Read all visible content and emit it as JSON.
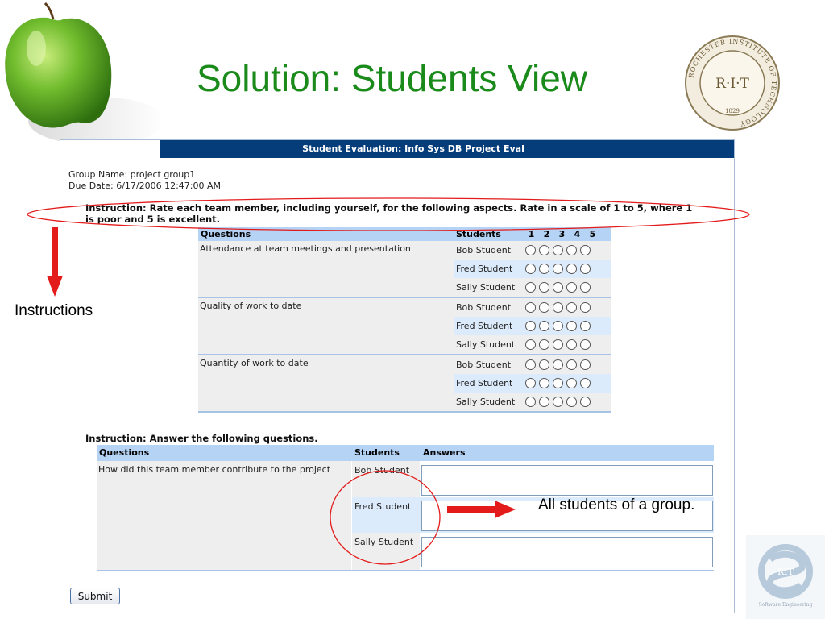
{
  "slide": {
    "title": "Solution: Students View"
  },
  "seal": {
    "center": "R·I·T",
    "ring": "ROCHESTER INSTITUTE OF TECHNOLOGY",
    "year": "1829"
  },
  "se_logo": {
    "monogram": "RIT",
    "caption": "Software Engineering"
  },
  "form": {
    "header_title": "Student Evaluation: Info Sys DB Project Eval",
    "group_name": "Group Name: project group1",
    "due_date": "Due Date: 6/17/2006 12:47:00 AM",
    "instruction_rating_1": "Instruction: Rate each team member, including yourself, for the following aspects. Rate in a scale of 1 to 5, where 1",
    "instruction_rating_2": "is poor and 5 is excellent.",
    "rating_table": {
      "col_questions": "Questions",
      "col_students": "Students",
      "scale": [
        "1",
        "2",
        "3",
        "4",
        "5"
      ],
      "questions": [
        {
          "text": "Attendance at team meetings and presentation",
          "students": [
            "Bob Student",
            "Fred Student",
            "Sally Student"
          ]
        },
        {
          "text": "Quality of work to date",
          "students": [
            "Bob Student",
            "Fred Student",
            "Sally Student"
          ]
        },
        {
          "text": "Quantity of work to date",
          "students": [
            "Bob Student",
            "Fred Student",
            "Sally Student"
          ]
        }
      ]
    },
    "instruction_answer": "Instruction: Answer the following questions.",
    "answer_table": {
      "col_questions": "Questions",
      "col_students": "Students",
      "col_answers": "Answers",
      "question": "How did this team member contribute to the project",
      "students": [
        "Bob Student",
        "Fred Student",
        "Sally Student"
      ]
    },
    "submit_label": "Submit"
  },
  "annotations": {
    "instructions_label": "Instructions",
    "students_label": "All students of a group.",
    "arrow_color": "#e31b1b"
  }
}
